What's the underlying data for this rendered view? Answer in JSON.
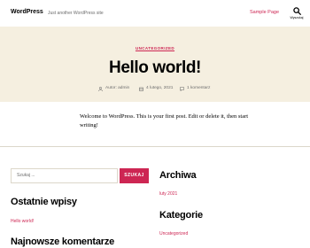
{
  "header": {
    "site_title": "WordPress",
    "tagline": "Just another WordPress site",
    "nav_sample_page": "Sample Page",
    "search_label": "Wyszukaj"
  },
  "post": {
    "category": "UNCATEGORIZED",
    "title": "Hello world!",
    "author": "Autor: admin",
    "date": "4 lutego, 2021",
    "comments": "1 komentarz",
    "content": "Welcome to WordPress. This is your first post. Edit or delete it, then start writing!"
  },
  "widgets": {
    "search_placeholder": "Szukaj ...",
    "search_button": "SZUKAJ",
    "recent_posts_title": "Ostatnie wpisy",
    "recent_post_1": "Hello world!",
    "recent_comments_title": "Najnowsze komentarze",
    "archives_title": "Archiwa",
    "archive_1": "luty 2021",
    "categories_title": "Kategorie",
    "category_1": "Uncategorized"
  },
  "colors": {
    "accent": "#cd2653",
    "header_bg": "#f5efe0",
    "text_muted": "#6d6d6d"
  }
}
